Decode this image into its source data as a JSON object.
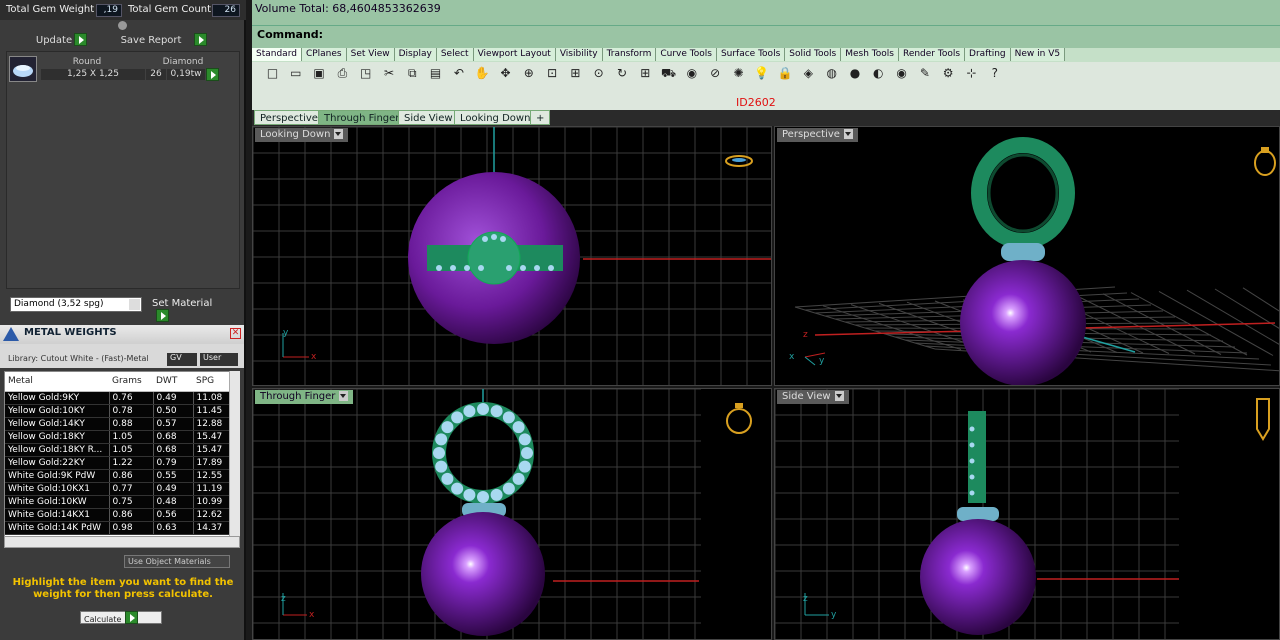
{
  "gem_summary": {
    "total_weight_label": "Total Gem Weight",
    "total_weight_value": ",19",
    "total_count_label": "Total Gem Count",
    "total_count_value": "26",
    "update_label": "Update",
    "save_report_label": "Save Report"
  },
  "gem_table": {
    "headers": [
      "Round",
      "Diamond"
    ],
    "size": "1,25 X 1,25",
    "count": "26",
    "weight": "0,19tw"
  },
  "material": {
    "selected": "Diamond    (3,52 spg)",
    "set_label": "Set Material"
  },
  "metal_weights": {
    "title": "METAL WEIGHTS",
    "library": "Library: Cutout White - (Fast)-Metal",
    "gv_label": "GV",
    "user_label": "User",
    "columns": [
      "Metal",
      "Grams",
      "DWT",
      "SPG"
    ],
    "rows": [
      [
        "Yellow Gold:9KY",
        "0.76",
        "0.49",
        "11.08"
      ],
      [
        "Yellow Gold:10KY",
        "0.78",
        "0.50",
        "11.45"
      ],
      [
        "Yellow Gold:14KY",
        "0.88",
        "0.57",
        "12.88"
      ],
      [
        "Yellow Gold:18KY",
        "1.05",
        "0.68",
        "15.47"
      ],
      [
        "Yellow Gold:18KY R...",
        "1.05",
        "0.68",
        "15.47"
      ],
      [
        "Yellow Gold:22KY",
        "1.22",
        "0.79",
        "17.89"
      ],
      [
        "White Gold:9K PdW",
        "0.86",
        "0.55",
        "12.55"
      ],
      [
        "White Gold:10KX1",
        "0.77",
        "0.49",
        "11.19"
      ],
      [
        "White Gold:10KW",
        "0.75",
        "0.48",
        "10.99"
      ],
      [
        "White Gold:14KX1",
        "0.86",
        "0.56",
        "12.62"
      ],
      [
        "White Gold:14K PdW",
        "0.98",
        "0.63",
        "14.37"
      ]
    ],
    "use_object_materials": "Use Object Materials",
    "hint": "Highlight the item you want to find the weight for then press calculate.",
    "calculate_label": "Calculate"
  },
  "command": {
    "volume": "Volume Total: 68,4604853362639",
    "prompt": "Command:"
  },
  "toolbar_tabs": [
    "Standard",
    "CPlanes",
    "Set View",
    "Display",
    "Select",
    "Viewport Layout",
    "Visibility",
    "Transform",
    "Curve Tools",
    "Surface Tools",
    "Solid Tools",
    "Mesh Tools",
    "Render Tools",
    "Drafting",
    "New in V5"
  ],
  "id_label": "ID2602",
  "viewport_tabs": [
    "Perspective",
    "Through Finger",
    "Side View",
    "Looking Down",
    "+"
  ],
  "viewports": {
    "top_left": "Looking Down",
    "top_right": "Perspective",
    "bottom_left": "Through Finger",
    "bottom_right": "Side View"
  },
  "colors": {
    "command_bg": "#9ac4a4",
    "sphere": "#6a1a9a",
    "ring": "#1d8a5e",
    "gem": "#a8d8f0",
    "grid": "#555555",
    "x_axis": "#c02020",
    "y_axis": "#20a0a0"
  }
}
